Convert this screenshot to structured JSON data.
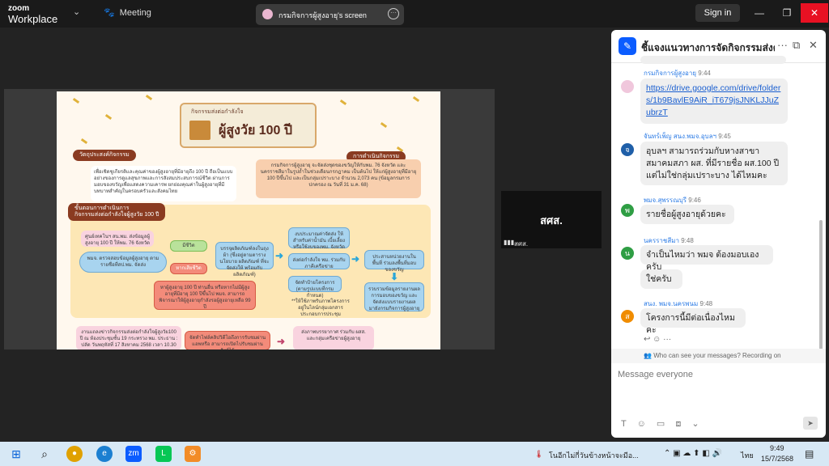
{
  "titlebar": {
    "brand_line1": "zoom",
    "brand_line2": "Workplace",
    "meeting_label": "Meeting",
    "share_label": "กรมกิจการผู้สูงอายุ's screen",
    "signin_label": "Sign in"
  },
  "slide": {
    "banner_small": "กิจกรรมส่งต่อกำลังใจ",
    "banner_big": "ผู้สูงวัย 100 ปี",
    "pill_objective": "วัตถุประสงค์กิจกรรม",
    "pill_operation": "การดำเนินกิจกรรม",
    "pill_process": "ขั้นตอนการดำเนินการ",
    "pill_process2": "กิจกรรมส่งต่อกำลังใจผู้สูงวัย 100 ปี",
    "objective_text": "เพื่อเชิดชูเกียรติและคุณค่าของผู้สูงอายุที่มีอายุถึง 100 ปี ถือเป็นแบบอย่างของการดูแลสุขภาพและการสังสมประสบการณ์ชีวิต ผ่านการมอบของขวัญเพื่อแสดงความเคารพ ยกย่องคุณค่าในผู้สูงอายุที่มีบทบาทสำคัญในครอบครัวและสังคมไทย",
    "operation_text": "กรมกิจการผู้สูงอายุ จะจัดส่งชุดของขวัญให้กับพม. 76 จังหวัด และนครราชสีมาในรูปถ้ำในช่วงเดือนกรกฎาคม เป็นต้นไป ให้แก่ผู้สูงอายุที่มีอายุ 100 ปีขึ้นไป และเป็นกลุ่มเปราะบาง จำนวน 2,073 คน (ข้อมูลกรมการปกครอง ณ วันที่ 31 ม.ค. 68)",
    "step_received": "ศูนย์เทคโนฯ สน.พม. ส่งข้อมูลผู้สูงอายุ 100 ปี ให้พม. 76 จังหวัด",
    "step_check": "พมจ. ตรวจสอบข้อมูลผู้สูงอายุ ตามรายชื่อที่สป.พม. จัดส่ง",
    "step_alive": "มีชีวิต",
    "step_dead": "หากเสียชีวิต",
    "step_dead_note": "หาผู้สูงอายุ 100 ปี ท่านอื่น หรือหากไม่มีผู้สูงอายุที่มีอายุ 100 ปีขึ้นไป พมจ. สามารถพิจารณาให้ผู้สูงอายุกำลังรอผู้สูงอายุเหลือ 99 ปี",
    "step_budget": "งบประมาณค่าจัดส่ง ให้สำหรับค่าน้ำมัน เบี้ยเลี้ยง หรือใช้งบของพม. จังหวัด",
    "step_items": "บรรจุผลิตภัณฑ์ลงในถุงผ้า (ซึ่งอยู่ตามตารางนโยบาย ผลิตภัณฑ์ ที่จะจัดส่งให้ พร้อมกับผลิตภัณฑ์)",
    "step_visit": "ส่งต่อกำลังใจ พม. ร่วมกับภาคีเครือข่าย",
    "step_photo": "จัดทำป้ายโครงการ (ตามรูปแบบที่กรมกำหนด)",
    "step_report": "ประสานหน่วยงานในพื้นที่ ร่วมลงพื้นที่มอบของขวัญ",
    "step_summary": "รวบรวมข้อมูลรายงานผล การมอบของขวัญ และจัดส่งแบบรายงานผลมายังกรมกิจการผู้สูงอายุ",
    "footnote": "**ให้ใช้ภาพรับภาพโครงการ อยู่ในไลน์กลุ่มเอกสารประกอบการประชุม",
    "bottom_left": "งานแถลงข่าวกิจกรรมส่งต่อกำลังใจผู้สูงวัย100 ปี ณ ห้องประชุมชั้น 19 กระทรวง พม. ประธาน : ปลัด วันพฤหัสที่ 17 สิงหาคม 2568 เวลา 10.30 น.",
    "bottom_mid": "จัดทำไฟล์คลิปวิดีโอถึงการรับชมผ่านแอพหรือ สามารถเปิดไปรับชมผ่านลิงก์ได้",
    "bottom_right": "ส่งภาพบรรยากาศ ร่วมกับ ผสส. และกลุ่มเครือข่ายผู้สูงอายุ"
  },
  "tile": {
    "name": "สศส.",
    "sub": "สศส."
  },
  "chat": {
    "title": "ชี้แจงแนวทางการจัดกิจกรรมส่งต่อก...",
    "messages": [
      {
        "sender": "กรมกิจการผู้สูงอายุ",
        "time": "9:44",
        "text": "https://drive.google.com/drive/folders/1b9BavlE9AiR_iT679jsJNKLJJuZubrzT"
      },
      {
        "sender": "จันทร์เพ็ญ สนง.พมจ.อุบลฯ",
        "time": "9:45",
        "avatar": "จ",
        "text": "อุบลฯ สามารถร่วมกับหางสาขาสมาคมสภา ผส. ที่มีรายชื่อ ผส.100 ปี แต่ไม่ใช่กลุ่มเปราะบาง ได้ไหมคะ"
      },
      {
        "sender": "พมจ.สุพรรณบุรี",
        "time": "9:46",
        "avatar": "พ",
        "text": "รายชื่อผู้สูงอายุด้วยคะ"
      },
      {
        "sender": "นครราชสีมา",
        "time": "9:48",
        "avatar": "น",
        "text": "จำเป็นไหมว่า พมจ ต้องมอบเองครับ",
        "text2": "ใช่ครับ"
      },
      {
        "sender": "สนง. พมจ.นครพนม",
        "time": "9:48",
        "avatar": "ส",
        "text": "โครงการนี้มีต่อเนื่องไหมคะ"
      }
    ],
    "notice": "Who can see your messages? Recording on",
    "placeholder": "Message everyone"
  },
  "taskbar": {
    "weather": "โนอีกไม่กี่วันข้างหน้าจะมีอ...",
    "lang": "ไทย",
    "time": "9:49",
    "date": "15/7/2568"
  }
}
